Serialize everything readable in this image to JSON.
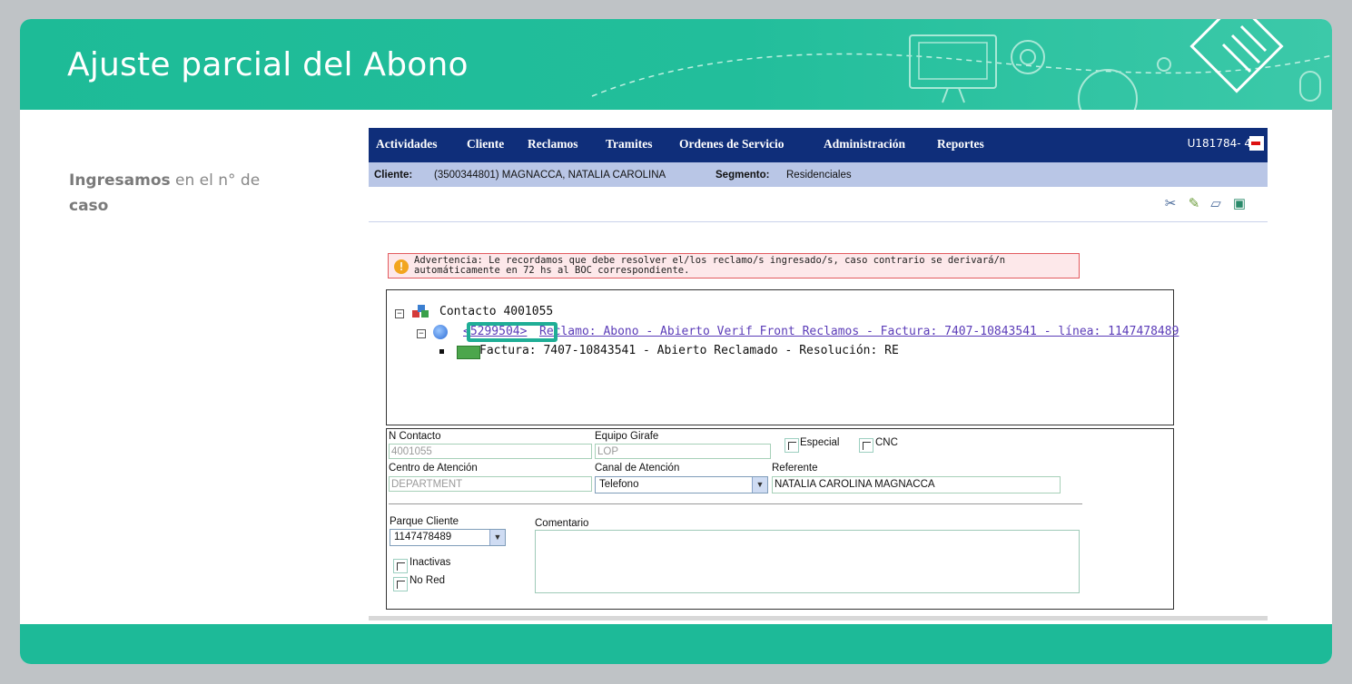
{
  "slide": {
    "title": "Ajuste parcial del Abono",
    "instruction_bold_1": "Ingresamos",
    "instruction_text": " en el n° de ",
    "instruction_bold_2": "caso"
  },
  "nav": {
    "items": [
      "Actividades",
      "Cliente",
      "Reclamos",
      "Tramites",
      "Ordenes de Servicio",
      "Administración",
      "Reportes"
    ],
    "user": "U181784- 4"
  },
  "client_bar": {
    "cliente_label": "Cliente:",
    "cliente_value": "(3500344801) MAGNACCA, NATALIA CAROLINA",
    "segmento_label": "Segmento:",
    "segmento_value": "Residenciales"
  },
  "warning": {
    "text": "Advertencia: Le recordamos que debe resolver el/los reclamo/s ingresado/s, caso contrario se derivará/n automáticamente en 72 hs al BOC correspondiente."
  },
  "tree": {
    "contact": "Contacto 4001055",
    "case_number": "<5299504>",
    "reclamo": "Reclamo: Abono - Abierto Verif Front Reclamos - Factura: 7407-10843541 - línea: 1147478489",
    "factura": "Factura: 7407-10843541 - Abierto Reclamado - Resolución: RE"
  },
  "form": {
    "n_contacto_label": "N Contacto",
    "n_contacto_value": "4001055",
    "equipo_label": "Equipo Girafe",
    "equipo_value": "LOP",
    "especial_label": "Especial",
    "cnc_label": "CNC",
    "centro_label": "Centro de Atención",
    "centro_value": "DEPARTMENT",
    "canal_label": "Canal de Atención",
    "canal_value": "Telefono",
    "referente_label": "Referente",
    "referente_value": "NATALIA CAROLINA MAGNACCA",
    "parque_label": "Parque Cliente",
    "parque_value": "1147478489",
    "comentario_label": "Comentario",
    "inactivas_label": "Inactivas",
    "nored_label": "No Red"
  },
  "colors": {
    "accent": "#1dbb97",
    "nav_bg": "#0f2e7a",
    "client_bar_bg": "#b9c6e6",
    "highlight": "#1fae96"
  }
}
